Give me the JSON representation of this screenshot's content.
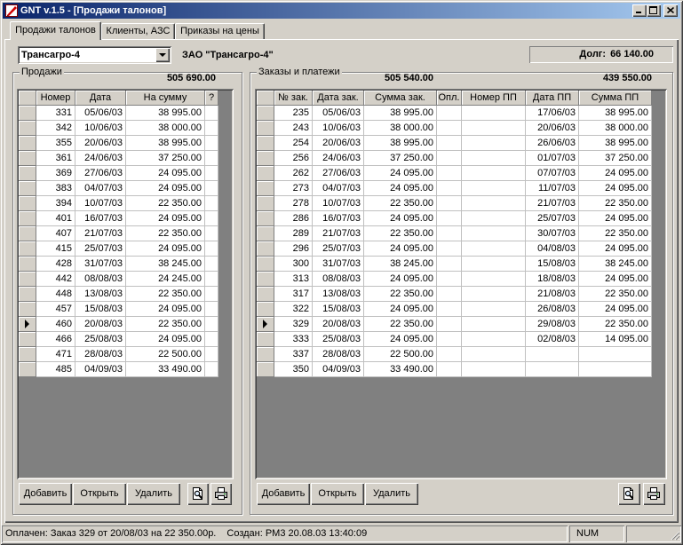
{
  "window": {
    "title": "GNT v.1.5 - [Продажи талонов]"
  },
  "colors": {
    "face": "#d4d0c8",
    "title_start": "#0a246a",
    "title_end": "#a6caf0",
    "grid_background": "#808080"
  },
  "icons": {
    "app": "app-icon",
    "minimize": "minimize-icon",
    "maximize": "maximize-icon",
    "close": "close-icon",
    "dropdown": "chevron-down-icon",
    "preview": "print-preview-icon",
    "print": "printer-icon",
    "current_row": "current-row-arrow-icon"
  },
  "tabs": [
    {
      "label": "Продажи талонов",
      "active": true
    },
    {
      "label": "Клиенты, АЗС",
      "active": false
    },
    {
      "label": "Приказы на цены",
      "active": false
    }
  ],
  "client": {
    "selected": "Трансагро-4",
    "full_name": "ЗАО \"Трансагро-4\"",
    "debt_label": "Долг:",
    "debt_value": "66 140.00"
  },
  "sales": {
    "title": "Продажи",
    "total": "505 690.00",
    "columns": {
      "number": "Номер",
      "date": "Дата",
      "amount": "На сумму",
      "flag": "?"
    },
    "rows": [
      {
        "number": "331",
        "date": "05/06/03",
        "amount": "38 995.00"
      },
      {
        "number": "342",
        "date": "10/06/03",
        "amount": "38 000.00"
      },
      {
        "number": "355",
        "date": "20/06/03",
        "amount": "38 995.00"
      },
      {
        "number": "361",
        "date": "24/06/03",
        "amount": "37 250.00"
      },
      {
        "number": "369",
        "date": "27/06/03",
        "amount": "24 095.00"
      },
      {
        "number": "383",
        "date": "04/07/03",
        "amount": "24 095.00"
      },
      {
        "number": "394",
        "date": "10/07/03",
        "amount": "22 350.00"
      },
      {
        "number": "401",
        "date": "16/07/03",
        "amount": "24 095.00"
      },
      {
        "number": "407",
        "date": "21/07/03",
        "amount": "22 350.00"
      },
      {
        "number": "415",
        "date": "25/07/03",
        "amount": "24 095.00"
      },
      {
        "number": "428",
        "date": "31/07/03",
        "amount": "38 245.00"
      },
      {
        "number": "442",
        "date": "08/08/03",
        "amount": "24 245.00"
      },
      {
        "number": "448",
        "date": "13/08/03",
        "amount": "22 350.00"
      },
      {
        "number": "457",
        "date": "15/08/03",
        "amount": "24 095.00"
      },
      {
        "number": "460",
        "date": "20/08/03",
        "amount": "22 350.00",
        "current": true
      },
      {
        "number": "466",
        "date": "25/08/03",
        "amount": "24 095.00"
      },
      {
        "number": "471",
        "date": "28/08/03",
        "amount": "22 500.00"
      },
      {
        "number": "485",
        "date": "04/09/03",
        "amount": "33 490.00"
      }
    ]
  },
  "orders": {
    "title": "Заказы и платежи",
    "total_orders": "505 540.00",
    "total_payments": "439 550.00",
    "columns": {
      "order_no": "№ зак.",
      "order_date": "Дата зак.",
      "order_sum": "Сумма зак.",
      "paid": "Опл.",
      "pp_no": "Номер ПП",
      "pp_date": "Дата ПП",
      "pp_sum": "Сумма ПП"
    },
    "rows": [
      {
        "order_no": "235",
        "order_date": "05/06/03",
        "order_sum": "38 995.00",
        "pp_date": "17/06/03",
        "pp_sum": "38 995.00"
      },
      {
        "order_no": "243",
        "order_date": "10/06/03",
        "order_sum": "38 000.00",
        "pp_date": "20/06/03",
        "pp_sum": "38 000.00"
      },
      {
        "order_no": "254",
        "order_date": "20/06/03",
        "order_sum": "38 995.00",
        "pp_date": "26/06/03",
        "pp_sum": "38 995.00"
      },
      {
        "order_no": "256",
        "order_date": "24/06/03",
        "order_sum": "37 250.00",
        "pp_date": "01/07/03",
        "pp_sum": "37 250.00"
      },
      {
        "order_no": "262",
        "order_date": "27/06/03",
        "order_sum": "24 095.00",
        "pp_date": "07/07/03",
        "pp_sum": "24 095.00"
      },
      {
        "order_no": "273",
        "order_date": "04/07/03",
        "order_sum": "24 095.00",
        "pp_date": "11/07/03",
        "pp_sum": "24 095.00"
      },
      {
        "order_no": "278",
        "order_date": "10/07/03",
        "order_sum": "22 350.00",
        "pp_date": "21/07/03",
        "pp_sum": "22 350.00"
      },
      {
        "order_no": "286",
        "order_date": "16/07/03",
        "order_sum": "24 095.00",
        "pp_date": "25/07/03",
        "pp_sum": "24 095.00"
      },
      {
        "order_no": "289",
        "order_date": "21/07/03",
        "order_sum": "22 350.00",
        "pp_date": "30/07/03",
        "pp_sum": "22 350.00"
      },
      {
        "order_no": "296",
        "order_date": "25/07/03",
        "order_sum": "24 095.00",
        "pp_date": "04/08/03",
        "pp_sum": "24 095.00"
      },
      {
        "order_no": "300",
        "order_date": "31/07/03",
        "order_sum": "38 245.00",
        "pp_date": "15/08/03",
        "pp_sum": "38 245.00"
      },
      {
        "order_no": "313",
        "order_date": "08/08/03",
        "order_sum": "24 095.00",
        "pp_date": "18/08/03",
        "pp_sum": "24 095.00"
      },
      {
        "order_no": "317",
        "order_date": "13/08/03",
        "order_sum": "22 350.00",
        "pp_date": "21/08/03",
        "pp_sum": "22 350.00"
      },
      {
        "order_no": "322",
        "order_date": "15/08/03",
        "order_sum": "24 095.00",
        "pp_date": "26/08/03",
        "pp_sum": "24 095.00"
      },
      {
        "order_no": "329",
        "order_date": "20/08/03",
        "order_sum": "22 350.00",
        "pp_date": "29/08/03",
        "pp_sum": "22 350.00",
        "current": true
      },
      {
        "order_no": "333",
        "order_date": "25/08/03",
        "order_sum": "24 095.00",
        "pp_date": "02/08/03",
        "pp_sum": "14 095.00"
      },
      {
        "order_no": "337",
        "order_date": "28/08/03",
        "order_sum": "22 500.00"
      },
      {
        "order_no": "350",
        "order_date": "04/09/03",
        "order_sum": "33 490.00"
      }
    ]
  },
  "buttons": {
    "add": "Добавить",
    "open": "Открыть",
    "delete": "Удалить"
  },
  "status": {
    "paid": "Оплачен: Заказ 329 от 20/08/03 на 22 350.00р.",
    "created": "Создан: PM3 20.08.03 13:40:09",
    "num": "NUM"
  }
}
